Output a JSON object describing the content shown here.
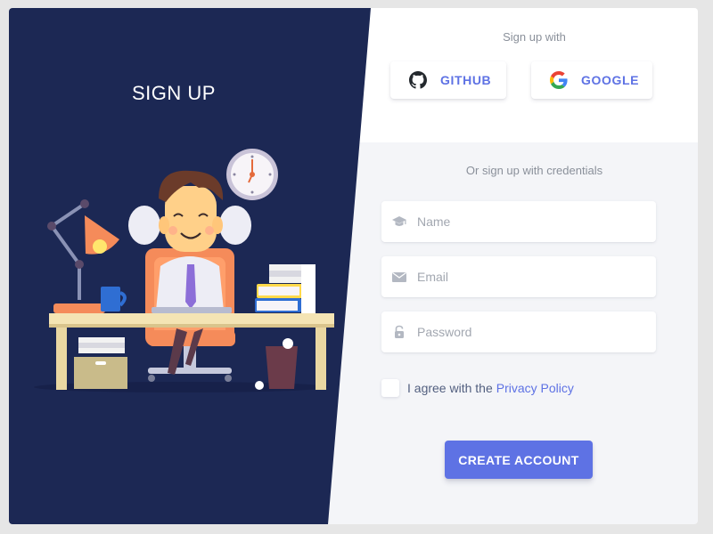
{
  "left_panel": {
    "title": "SIGN UP",
    "illustration": "person-relaxing-at-desk"
  },
  "social": {
    "heading": "Sign up with",
    "buttons": [
      {
        "label": "GITHUB",
        "icon": "github-icon"
      },
      {
        "label": "GOOGLE",
        "icon": "google-icon"
      }
    ]
  },
  "form": {
    "subheading": "Or sign up with credentials",
    "fields": [
      {
        "placeholder": "Name",
        "value": "",
        "icon": "graduation-cap-icon"
      },
      {
        "placeholder": "Email",
        "value": "",
        "icon": "envelope-icon"
      },
      {
        "placeholder": "Password",
        "value": "",
        "icon": "lock-icon"
      }
    ],
    "agree_text": "I agree with the",
    "privacy_link": "Privacy Policy",
    "agree_checked": false,
    "submit_label": "CREATE ACCOUNT"
  },
  "colors": {
    "left_bg": "#1c2854",
    "accent": "#5e72e4",
    "form_bg": "#f4f5f8",
    "top_bg": "#ffffff"
  }
}
